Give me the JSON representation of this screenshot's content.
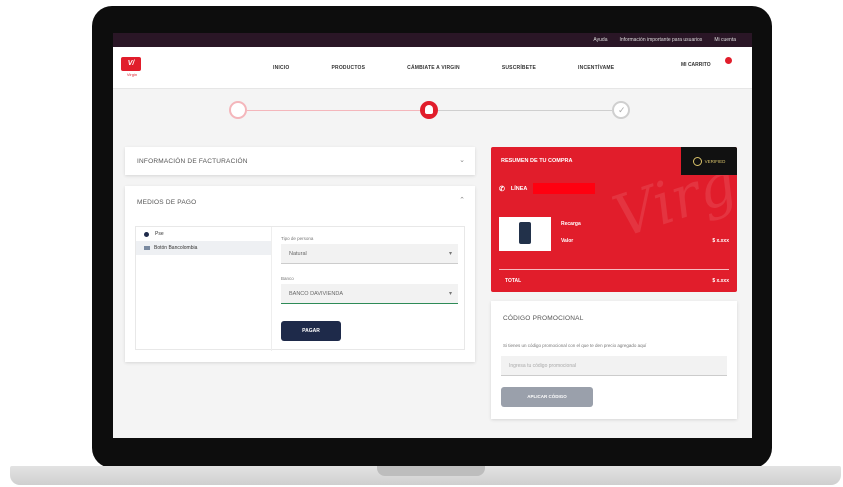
{
  "utility_bar": {
    "help": "Ayuda",
    "info": "Información importante para usuarios",
    "account": "Mi cuenta"
  },
  "brand": {
    "logo_text": "V/",
    "logo_sub": "Virgin"
  },
  "nav": {
    "items": [
      "INICIO",
      "PRODUCTOS",
      "CÁMBIATE A VIRGIN",
      "SUSCRÍBETE",
      "INCENTÍVAME"
    ],
    "cart": "MI CARRITO"
  },
  "stepper": {
    "current_step": 2,
    "total_steps": 3
  },
  "billing": {
    "title": "INFORMACIÓN DE FACTURACIÓN"
  },
  "payment": {
    "title": "MEDIOS DE PAGO",
    "methods": [
      "Pse",
      "Botón Bancolombia"
    ],
    "person_type": {
      "label": "Tipo de persona",
      "value": "Natural"
    },
    "bank": {
      "label": "Banco",
      "value": "BANCO DAVIVIENDA"
    },
    "pay_button": "PAGAR"
  },
  "summary": {
    "title": "RESUMEN DE TU COMPRA",
    "secure": "VERIFIED",
    "line_label": "LÍNEA",
    "product_name": "Recarga",
    "product_value_label": "Valor",
    "product_price": "$ x.xxx",
    "total_label": "TOTAL",
    "total_value": "$ x.xxx",
    "watermark": "Virgin"
  },
  "promo": {
    "title": "CÓDIGO PROMOCIONAL",
    "hint": "Si tienes un código promocional con el que te den precio agregado aquí",
    "placeholder": "Ingresa tu código promocional",
    "button": "APLICAR CÓDIGO"
  },
  "colors": {
    "brand_red": "#e11d2b",
    "navy": "#1e2a4a",
    "topbar": "#2a1626"
  }
}
